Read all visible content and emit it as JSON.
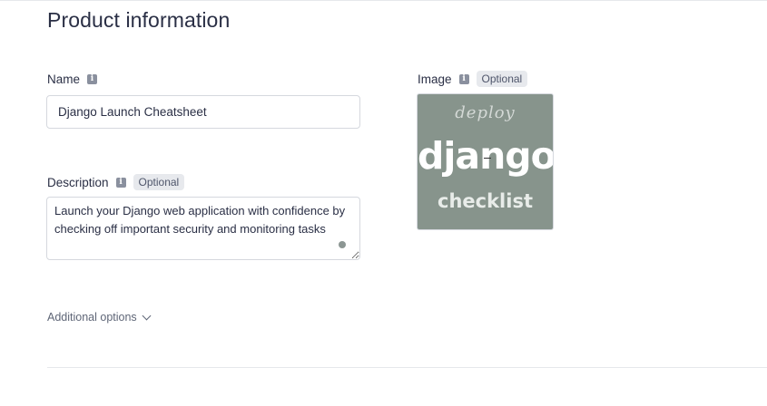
{
  "form": {
    "title": "Product information",
    "name": {
      "label": "Name",
      "value": "Django Launch Cheatsheet"
    },
    "description": {
      "label": "Description",
      "optional": "Optional",
      "value": "Launch your Django web application with confidence by checking off important security and monitoring tasks"
    },
    "image": {
      "label": "Image",
      "optional": "Optional",
      "thumbnail": {
        "line1": "deploy",
        "line2": "django",
        "line3": "checklist",
        "background": "#87948c"
      }
    },
    "additional_options": "Additional options"
  },
  "icons": {
    "info": "info-icon",
    "chevron": "chevron-down-icon"
  }
}
